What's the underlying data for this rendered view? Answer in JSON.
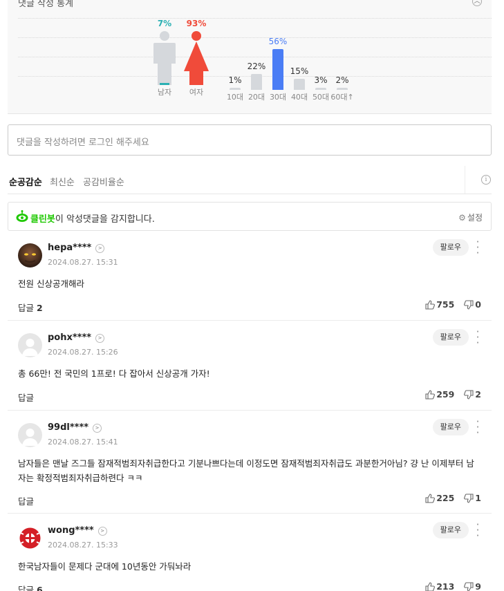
{
  "stats": {
    "title": "댓글 작성 통계",
    "gender": [
      {
        "label": "남자",
        "pct": "7%",
        "color": "#2ab0b3",
        "value": 7
      },
      {
        "label": "여자",
        "pct": "93%",
        "color": "#f04b3a",
        "value": 93
      }
    ],
    "age": [
      {
        "label": "10대",
        "pct": "1%",
        "value": 1
      },
      {
        "label": "20대",
        "pct": "22%",
        "value": 22
      },
      {
        "label": "30대",
        "pct": "56%",
        "value": 56
      },
      {
        "label": "40대",
        "pct": "15%",
        "value": 15
      },
      {
        "label": "50대",
        "pct": "3%",
        "value": 3
      },
      {
        "label": "60대↑",
        "pct": "2%",
        "value": 2
      }
    ],
    "highlight_color": "#4a7df5"
  },
  "login_prompt": "댓글을 작성하려면 로그인 해주세요",
  "sort": {
    "tabs": [
      "순공감순",
      "최신순",
      "공감비율순"
    ],
    "active": 0
  },
  "cleanbot": {
    "name": "클린봇",
    "message": "이 악성댓글을 감지합니다.",
    "settings_label": "설정"
  },
  "follow_label": "팔로우",
  "reply_label": "답글",
  "comments": [
    {
      "user": "hepa****",
      "time": "2024.08.27. 15:31",
      "text": "전원 신상공개해라",
      "replies": "2",
      "likes": "755",
      "dislikes": "0",
      "avatar": "photo-dark"
    },
    {
      "user": "pohx****",
      "time": "2024.08.27. 15:26",
      "text": "총 66만! 전 국민의 1프로! 다 잡아서 신상공개 가자!",
      "replies": "",
      "likes": "259",
      "dislikes": "2",
      "avatar": "default"
    },
    {
      "user": "99dl****",
      "time": "2024.08.27. 15:41",
      "text": "남자들은 맨날 즈그들 잠재적범죄자취급한다고 기분나쁘다는데 이정도면 잠재적범죄자취급도 과분한거아님? 걍 난 이제부터 남자는 확정적범죄자취급하련다 ㅋㅋ",
      "replies": "",
      "likes": "225",
      "dislikes": "1",
      "avatar": "default"
    },
    {
      "user": "wong****",
      "time": "2024.08.27. 15:33",
      "text": "한국남자들이 문제다 군대에 10년동안 가둬놔라",
      "replies": "6",
      "likes": "213",
      "dislikes": "9",
      "avatar": "emblem-red"
    }
  ]
}
